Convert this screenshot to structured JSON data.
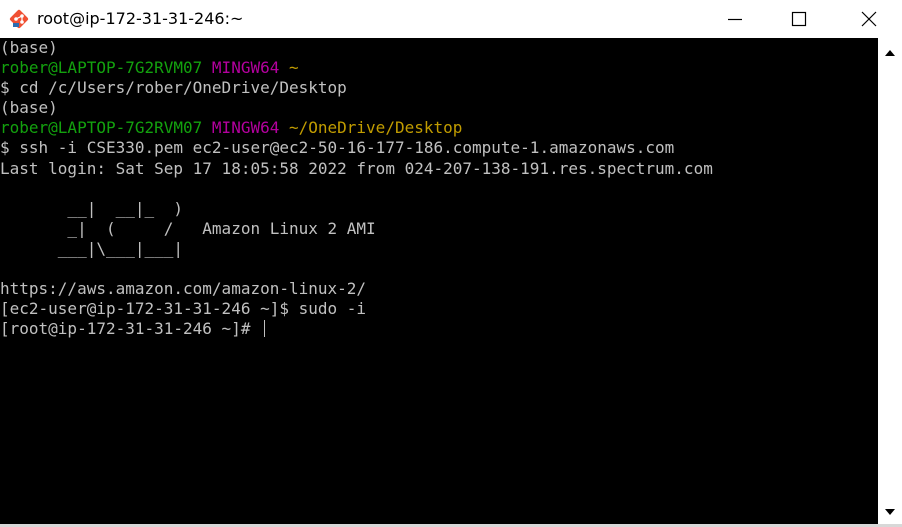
{
  "window": {
    "title": "root@ip-172-31-31-246:~"
  },
  "terminal": {
    "lines": [
      {
        "segments": [
          {
            "text": "(base)",
            "color": "default"
          }
        ]
      },
      {
        "segments": [
          {
            "text": "rober@LAPTOP-7G2RVM07 ",
            "color": "green"
          },
          {
            "text": "MINGW64 ",
            "color": "magenta"
          },
          {
            "text": "~",
            "color": "yellow"
          }
        ]
      },
      {
        "segments": [
          {
            "text": "$ cd /c/Users/rober/OneDrive/Desktop",
            "color": "default"
          }
        ]
      },
      {
        "segments": [
          {
            "text": "(base)",
            "color": "default"
          }
        ]
      },
      {
        "segments": [
          {
            "text": "rober@LAPTOP-7G2RVM07 ",
            "color": "green"
          },
          {
            "text": "MINGW64 ",
            "color": "magenta"
          },
          {
            "text": "~/OneDrive/Desktop",
            "color": "yellow"
          }
        ]
      },
      {
        "segments": [
          {
            "text": "$ ssh -i CSE330.pem ec2-user@ec2-50-16-177-186.compute-1.amazonaws.com",
            "color": "default"
          }
        ]
      },
      {
        "segments": [
          {
            "text": "Last login: Sat Sep 17 18:05:58 2022 from 024-207-138-191.res.spectrum.com",
            "color": "default"
          }
        ]
      },
      {
        "segments": [
          {
            "text": "",
            "color": "default"
          }
        ]
      },
      {
        "segments": [
          {
            "text": "       __|  __|_  )",
            "color": "default"
          }
        ]
      },
      {
        "segments": [
          {
            "text": "       _|  (     /   Amazon Linux 2 AMI",
            "color": "default"
          }
        ]
      },
      {
        "segments": [
          {
            "text": "      ___|\\___|___|",
            "color": "default"
          }
        ]
      },
      {
        "segments": [
          {
            "text": "",
            "color": "default"
          }
        ]
      },
      {
        "segments": [
          {
            "text": "https://aws.amazon.com/amazon-linux-2/",
            "color": "default"
          }
        ]
      },
      {
        "segments": [
          {
            "text": "[ec2-user@ip-172-31-31-246 ~]$ sudo -i",
            "color": "default"
          }
        ]
      },
      {
        "segments": [
          {
            "text": "[root@ip-172-31-31-246 ~]# ",
            "color": "default"
          }
        ],
        "cursor": true
      }
    ]
  },
  "colors": {
    "default": "#c0c0c0",
    "green": "#13a10e",
    "magenta": "#b4009e",
    "yellow": "#c19c00",
    "background": "#000000",
    "titlebar": "#ffffff"
  },
  "icons": {
    "app": "git-bash-icon",
    "minimize": "minimize-icon",
    "maximize": "maximize-icon",
    "close": "close-icon",
    "scroll_up": "arrow-up-icon",
    "scroll_down": "arrow-down-icon"
  }
}
